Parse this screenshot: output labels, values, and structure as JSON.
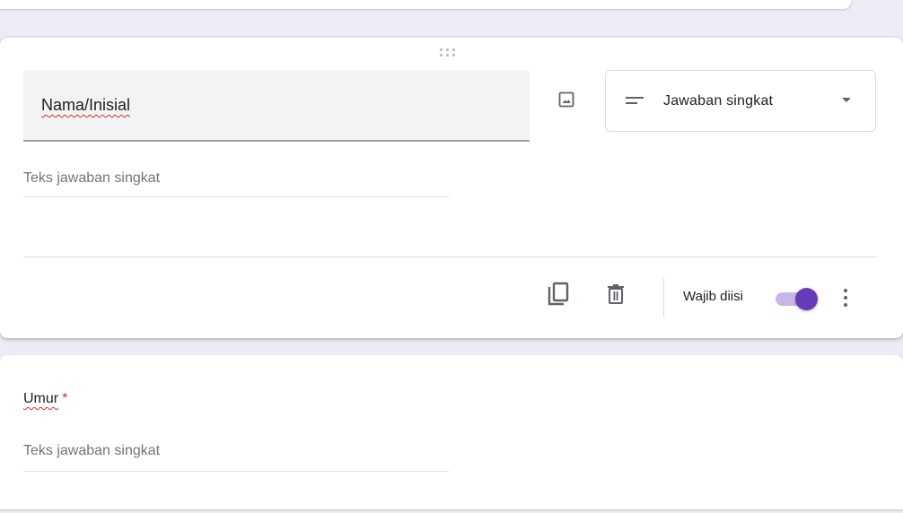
{
  "active_question": {
    "title": "Nama/Inisial",
    "type_select": {
      "selected": "Jawaban singkat"
    },
    "answer_placeholder": "Teks jawaban singkat",
    "required_label": "Wajib diisi",
    "required": true
  },
  "next_question": {
    "title": "Umur",
    "required_marker": "*",
    "answer_placeholder": "Teks jawaban singkat"
  },
  "colors": {
    "accent": "#673ab7",
    "toggle_track": "#c8b6ea",
    "required_star": "#d93025",
    "background": "#efebf6"
  },
  "icons": [
    "drag-handle-icon",
    "image-icon",
    "short-answer-icon",
    "dropdown-arrow-icon",
    "copy-icon",
    "trash-icon",
    "more-vert-icon"
  ]
}
